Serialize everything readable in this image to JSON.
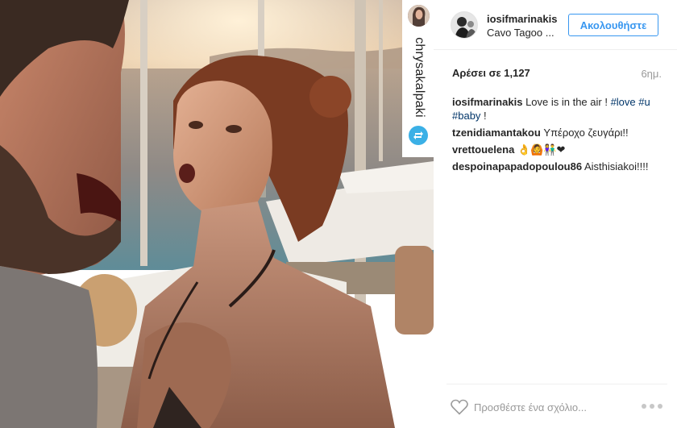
{
  "post": {
    "photo_icon": "couple-beach-photo",
    "repost": {
      "username": "chrysakalpaki",
      "icon": "repost-icon",
      "accent": "#3bb0e6"
    }
  },
  "header": {
    "username": "iosifmarinakis",
    "location": "Cavo Tagoo ...",
    "follow_label": "Ακολουθήστε",
    "accent": "#3897f0"
  },
  "stats": {
    "likes": "Αρέσει σε 1,127",
    "time": "6ημ."
  },
  "caption": {
    "username": "iosifmarinakis",
    "text": "Love is in the air ! ",
    "tag1": "#love",
    "tag2": "#u",
    "tag3": "#baby",
    "end": " !"
  },
  "comments": [
    {
      "username": "tzenidiamantakou",
      "text": "Υπέροχο ζευγάρι!!"
    },
    {
      "username": "vrettouelena",
      "text": "👌🙆👫❤"
    },
    {
      "username": "despoinapapadopoulou86",
      "text": "Aisthisiakoi!!!!"
    }
  ],
  "footer": {
    "heart_icon": "heart-icon",
    "comment_placeholder": "Προσθέστε ένα σχόλιο...",
    "more_icon": "more-options-icon"
  }
}
